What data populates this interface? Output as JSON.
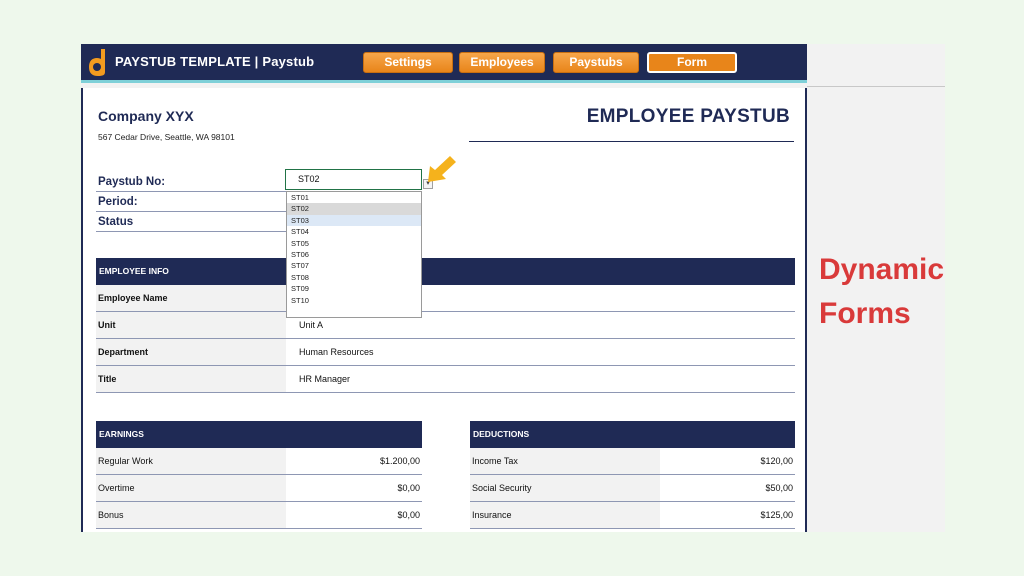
{
  "header": {
    "app_title": "PAYSTUB TEMPLATE | Paystub",
    "nav": [
      {
        "label": "Settings"
      },
      {
        "label": "Employees"
      },
      {
        "label": "Paystubs"
      },
      {
        "label": "Form",
        "active": true
      }
    ],
    "brand_color": "#1f2a55",
    "accent_color": "#e8851a"
  },
  "company": {
    "name": "Company XYX",
    "address": "567 Cedar Drive, Seattle, WA 98101"
  },
  "document_title": "EMPLOYEE PAYSTUB",
  "fields": {
    "paystub_no_label": "Paystub No:",
    "paystub_no_value": "ST02",
    "period_label": "Period:",
    "status_label": "Status"
  },
  "dropdown": {
    "options": [
      "ST01",
      "ST02",
      "ST03",
      "ST04",
      "ST05",
      "ST06",
      "ST07",
      "ST08",
      "ST09",
      "ST10"
    ],
    "selected": "ST02",
    "hover": "ST03"
  },
  "employee_info": {
    "heading": "EMPLOYEE INFO",
    "rows": [
      {
        "label": "Employee Name",
        "value": ""
      },
      {
        "label": "Unit",
        "value": "Unit A"
      },
      {
        "label": "Department",
        "value": "Human Resources"
      },
      {
        "label": "Title",
        "value": "HR Manager"
      }
    ]
  },
  "earnings": {
    "heading": "EARNINGS",
    "rows": [
      {
        "label": "Regular Work",
        "value": "$1.200,00"
      },
      {
        "label": "Overtime",
        "value": "$0,00"
      },
      {
        "label": "Bonus",
        "value": "$0,00"
      }
    ]
  },
  "deductions": {
    "heading": "DEDUCTIONS",
    "rows": [
      {
        "label": "Income Tax",
        "value": "$120,00"
      },
      {
        "label": "Social Security",
        "value": "$50,00"
      },
      {
        "label": "Insurance",
        "value": "$125,00"
      }
    ]
  },
  "side_caption": {
    "line1": "Dynamic",
    "line2": "Forms",
    "color": "#d93a3a"
  }
}
